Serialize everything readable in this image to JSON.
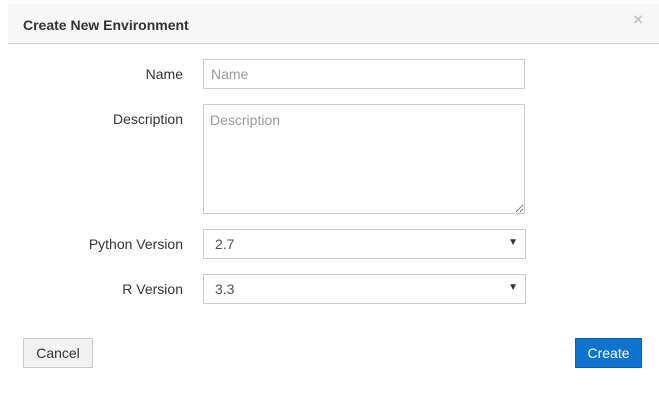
{
  "dialog": {
    "title": "Create New Environment",
    "close_glyph": "×"
  },
  "form": {
    "name": {
      "label": "Name",
      "value": "",
      "placeholder": "Name"
    },
    "description": {
      "label": "Description",
      "value": "",
      "placeholder": "Description"
    },
    "python_version": {
      "label": "Python Version",
      "selected": "2.7"
    },
    "r_version": {
      "label": "R Version",
      "selected": "3.3"
    }
  },
  "buttons": {
    "cancel_label": "Cancel",
    "create_label": "Create"
  },
  "icons": {
    "close": "close-icon",
    "dropdown": "caret-down-icon"
  },
  "colors": {
    "primary": "#0e72cf",
    "header_bg": "#f7f7f7"
  }
}
